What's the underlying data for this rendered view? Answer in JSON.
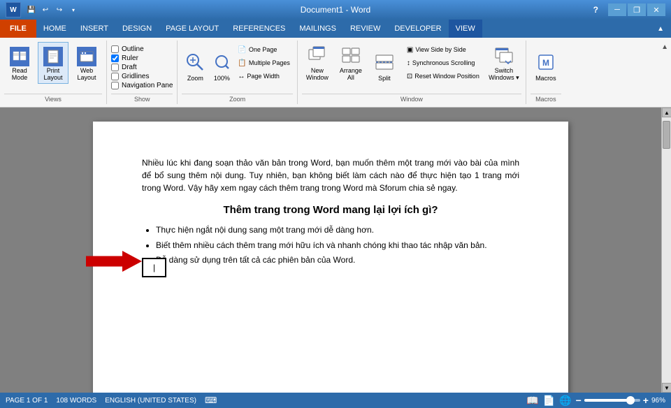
{
  "titleBar": {
    "title": "Document1 - Word",
    "helpBtn": "?",
    "minimizeBtn": "─",
    "restoreBtn": "❐",
    "closeBtn": "✕"
  },
  "quickAccess": {
    "save": "💾",
    "undo": "↩",
    "redo": "↪",
    "more": "▾"
  },
  "menuBar": {
    "items": [
      "FILE",
      "HOME",
      "INSERT",
      "DESIGN",
      "PAGE LAYOUT",
      "REFERENCES",
      "MAILINGS",
      "REVIEW",
      "DEVELOPER",
      "VIEW"
    ]
  },
  "ribbon": {
    "views": {
      "label": "Views",
      "buttons": [
        {
          "id": "read-mode",
          "text": "Read\nMode"
        },
        {
          "id": "print-layout",
          "text": "Print\nLayout"
        },
        {
          "id": "web-layout",
          "text": "Web\nLayout"
        }
      ]
    },
    "show": {
      "label": "Show",
      "items": [
        "Outline",
        "Ruler",
        "Draft",
        "Gridlines",
        "Navigation Pane"
      ]
    },
    "zoom": {
      "label": "Zoom",
      "zoomBtn": "Zoom",
      "zoomPct": "100%",
      "options": [
        "One Page",
        "Multiple Pages",
        "Page Width"
      ]
    },
    "window": {
      "label": "Window",
      "newWindow": "New\nWindow",
      "arrangeAll": "Arrange\nAll",
      "split": "Split",
      "sideBySide": "View Side by Side",
      "syncScrolling": "Synchronous Scrolling",
      "resetWindow": "Reset Window Position",
      "switchWindows": "Switch\nWindows"
    },
    "macros": {
      "label": "Macros",
      "macrosBtn": "Macros"
    }
  },
  "document": {
    "paragraph": "Nhiều lúc khi đang soạn thảo văn bản trong Word, bạn muốn thêm một trang mới vào bài của mình để bổ sung thêm nội dung. Tuy nhiên, bạn không biết làm cách nào để thực hiện tạo 1 trang mới trong Word. Vậy hãy xem ngay cách thêm trang trong Word mà Sforum chia sẻ ngay.",
    "heading": "Thêm trang trong Word mang lại lợi ích gì?",
    "bullets": [
      "Thực hiện ngắt nội dung sang một trang mới dễ dàng hơn.",
      "Biết thêm nhiều cách thêm trang mới hữu ích và nhanh chóng khi thao tác nhập văn bản.",
      "Dễ dàng sử dụng trên tất cả các phiên bản của Word."
    ]
  },
  "statusBar": {
    "page": "PAGE 1 OF 1",
    "words": "108 WORDS",
    "language": "ENGLISH (UNITED STATES)",
    "zoom": "96%"
  }
}
